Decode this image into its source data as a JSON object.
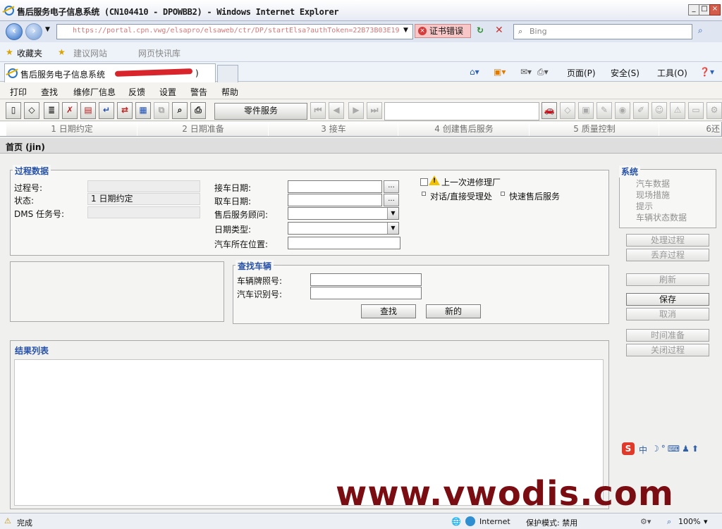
{
  "window": {
    "title": "售后服务电子信息系统 (CN104410 - DPOWBB2) - Windows Internet Explorer"
  },
  "address": {
    "url": "https://portal.cpn.vwg/elsapro/elsaweb/ctr/DP/startElsa?authToken=22B73B03E19",
    "cert_error": "证书错误",
    "search_placeholder": "Bing"
  },
  "favorites": {
    "label": "收藏夹",
    "suggested": "建议网站",
    "webslice": "网页快讯库"
  },
  "tab": {
    "title": "售后服务电子信息系统",
    "suffix": ")"
  },
  "ie_commands": {
    "page": "页面(P)",
    "safety": "安全(S)",
    "tools": "工具(O)"
  },
  "menu": [
    "打印",
    "查找",
    "维修厂信息",
    "反馈",
    "设置",
    "警告",
    "帮助"
  ],
  "toolbar": {
    "parts_service": "零件服务"
  },
  "process_tabs": [
    "1 日期约定",
    "2 日期准备",
    "3 接车",
    "4 创建售后服务",
    "5 质量控制",
    "6还"
  ],
  "breadcrumb": "首页 (jin)",
  "process_data": {
    "title": "过程数据",
    "process_no_label": "过程号:",
    "status_label": "状态:",
    "status_value": "1 日期约定",
    "dms_label": "DMS 任务号:",
    "pickup_date_label": "接车日期:",
    "return_date_label": "取车日期:",
    "advisor_label": "售后服务顾问:",
    "date_type_label": "日期类型:",
    "location_label": "汽车所在位置:",
    "last_visit_label": "上一次进修理厂",
    "dialog_label": "对话/直接受理处",
    "express_label": "快速售后服务"
  },
  "find_vehicle": {
    "title": "查找车辆",
    "plate_label": "车辆牌照号:",
    "vin_label": "汽车识别号:",
    "find_button": "查找",
    "new_button": "新的"
  },
  "results": {
    "title": "结果列表"
  },
  "system": {
    "title": "系统",
    "links": [
      "汽车数据",
      "现场措施",
      "提示",
      "车辆状态数据"
    ]
  },
  "side_buttons": {
    "process": "处理过程",
    "discard": "丢弃过程",
    "refresh": "刷新",
    "save": "保存",
    "cancel": "取消",
    "time_prep": "时间准备",
    "close_process": "关闭过程"
  },
  "ime": "中",
  "status_bar": {
    "done": "完成",
    "zone": "Internet",
    "protected_mode": "保护模式: 禁用",
    "zoom": "100%"
  },
  "watermark": "www.vwodis.com"
}
